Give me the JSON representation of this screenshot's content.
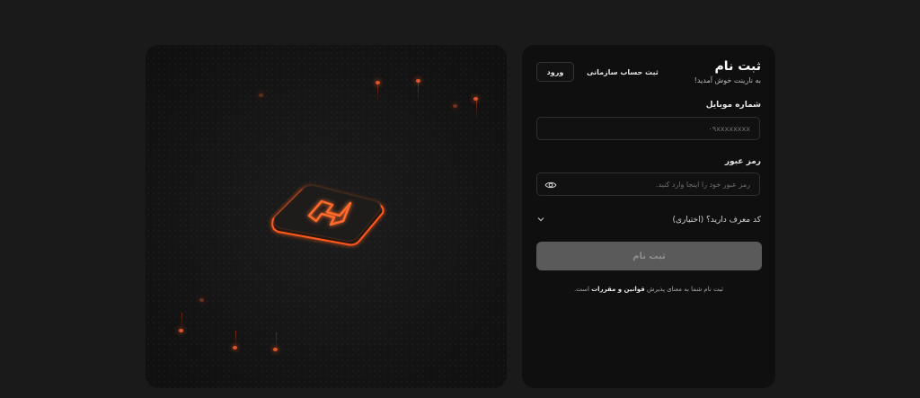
{
  "header": {
    "title": "ثبت نام",
    "subtitle": "به نارینت خوش آمدید!",
    "org_link": "ثبت حساب سازمانی",
    "login_label": "ورود"
  },
  "form": {
    "mobile_label": "شماره موبایل",
    "mobile_placeholder": "۰۹xxxxxxxx",
    "password_label": "رمز عبور",
    "password_placeholder": "رمز عبور خود را اینجا وارد کنید.",
    "referral_label": "کد معرف دارید؟ (اختیاری)",
    "submit_label": "ثبت نام"
  },
  "terms": {
    "prefix": "ثبت نام شما به معنای پذیرش",
    "link": "قوانین و مقررات",
    "suffix": "است."
  },
  "colors": {
    "background": "#1a1a1a",
    "card": "#0f0f0f",
    "accent_glow": "#ff5a1f",
    "submit_disabled": "#5a5a5a"
  },
  "icons": [
    "logo-chip-icon",
    "eye-icon",
    "chevron-down-icon"
  ]
}
